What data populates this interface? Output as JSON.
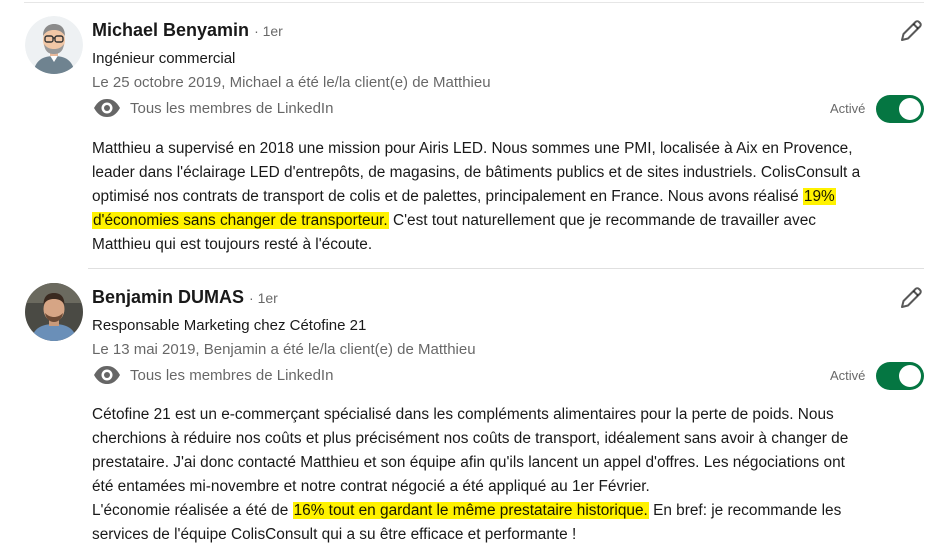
{
  "recommendations": [
    {
      "name": "Michael Benyamin",
      "degree": "· 1er",
      "headline": "Ingénieur commercial",
      "meta": "Le 25 octobre 2019, Michael a été le/la client(e) de Matthieu",
      "visibility_label": "Tous les membres de LinkedIn",
      "status": "Activé",
      "toggle_on": true,
      "text": {
        "l1": "Matthieu a supervisé en 2018 une mission pour Airis LED. Nous sommes une PMI, localisée à Aix en Provence,",
        "l2": "leader dans l'éclairage LED d'entrepôts, de magasins, de bâtiments publics et de sites industriels. ColisConsult a",
        "l3_before": "optimisé nos contrats de transport de colis et de palettes, principalement en France. Nous avons réalisé ",
        "l3_highlight": "19%",
        "l4_highlight": "d'économies sans changer de transporteur.",
        "l4_after": " C'est tout naturellement que je recommande de travailler avec",
        "l5": "Matthieu qui est toujours resté à l'écoute."
      }
    },
    {
      "name": "Benjamin DUMAS",
      "degree": "· 1er",
      "headline": "Responsable Marketing chez Cétofine 21",
      "meta": "Le 13 mai 2019, Benjamin a été le/la client(e) de Matthieu",
      "visibility_label": "Tous les membres de LinkedIn",
      "status": "Activé",
      "toggle_on": true,
      "text": {
        "l1": "Cétofine 21 est un e-commerçant spécialisé dans les compléments alimentaires pour la perte de poids. Nous",
        "l2": "cherchions à réduire nos coûts et plus précisément nos coûts de transport,  idéalement sans avoir à changer de",
        "l3": "prestataire. J'ai donc contacté Matthieu et son équipe afin qu'ils lancent un appel d'offres. Les négociations ont",
        "l4": "été entamées mi-novembre et notre contrat négocié a été appliqué au 1er Février.",
        "l5_before": "L'économie réalisée a été de ",
        "l5_highlight": "16% tout en gardant le même prestataire historique.",
        "l5_after": " En bref: je recommande les",
        "l6": "services de l'équipe ColisConsult qui a su être efficace et performante !"
      }
    }
  ],
  "colors": {
    "toggle_on": "#057642",
    "highlight": "#fff200",
    "secondary_text": "rgba(0,0,0,0.6)"
  },
  "icons": {
    "visibility": "eye-icon",
    "edit": "pencil-icon"
  }
}
